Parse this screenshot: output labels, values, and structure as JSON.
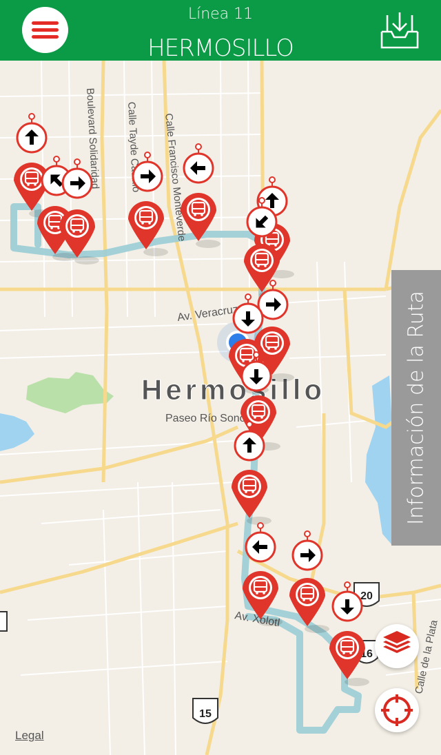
{
  "header": {
    "subtitle": "Línea 11",
    "title": "HERMOSILLO",
    "menu_icon": "hamburger-menu-icon",
    "download_icon": "inbox-download-icon"
  },
  "map": {
    "city_label": "Hermosillo",
    "street_labels": {
      "solidaridad": "Boulevard Solidaridad",
      "tayde": "Calle Tayde Castillo",
      "monteverde": "Calle Francisco Monteverde",
      "veracruz": "Av. Veracruz",
      "rio_sonora": "Paseo Río Sonora N",
      "xolotl": "Av. Xolotl",
      "la_plata": "Calle de la Plata"
    },
    "highway_shields": {
      "h15": "15",
      "h20": "20",
      "h16": "16"
    },
    "markers": [
      {
        "type": "bus-stop-marker"
      },
      {
        "type": "bus-stop-marker"
      },
      {
        "type": "bus-stop-marker"
      },
      {
        "type": "bus-stop-marker"
      },
      {
        "type": "bus-stop-marker"
      },
      {
        "type": "bus-stop-marker"
      },
      {
        "type": "bus-stop-marker"
      },
      {
        "type": "bus-stop-marker"
      },
      {
        "type": "bus-stop-marker"
      },
      {
        "type": "bus-stop-marker"
      },
      {
        "type": "bus-stop-marker"
      },
      {
        "type": "bus-stop-marker"
      },
      {
        "type": "bus-stop-marker"
      },
      {
        "type": "bus-stop-marker"
      },
      {
        "type": "bus-stop-marker"
      }
    ],
    "arrows": [
      {
        "dir": "up"
      },
      {
        "dir": "up-left"
      },
      {
        "dir": "right"
      },
      {
        "dir": "right"
      },
      {
        "dir": "left"
      },
      {
        "dir": "up"
      },
      {
        "dir": "down-left"
      },
      {
        "dir": "right"
      },
      {
        "dir": "down"
      },
      {
        "dir": "down"
      },
      {
        "dir": "up"
      },
      {
        "dir": "left"
      },
      {
        "dir": "right"
      },
      {
        "dir": "down"
      }
    ]
  },
  "side_tab": {
    "label": "Información de la Ruta"
  },
  "buttons": {
    "layers_icon": "layers-icon",
    "locate_icon": "crosshair-locate-icon"
  },
  "legal": "Legal",
  "colors": {
    "header_green": "#0b9a45",
    "marker_red": "#e0352b",
    "route": "#9fcfd6",
    "tab_gray": "#9a9a9a"
  }
}
